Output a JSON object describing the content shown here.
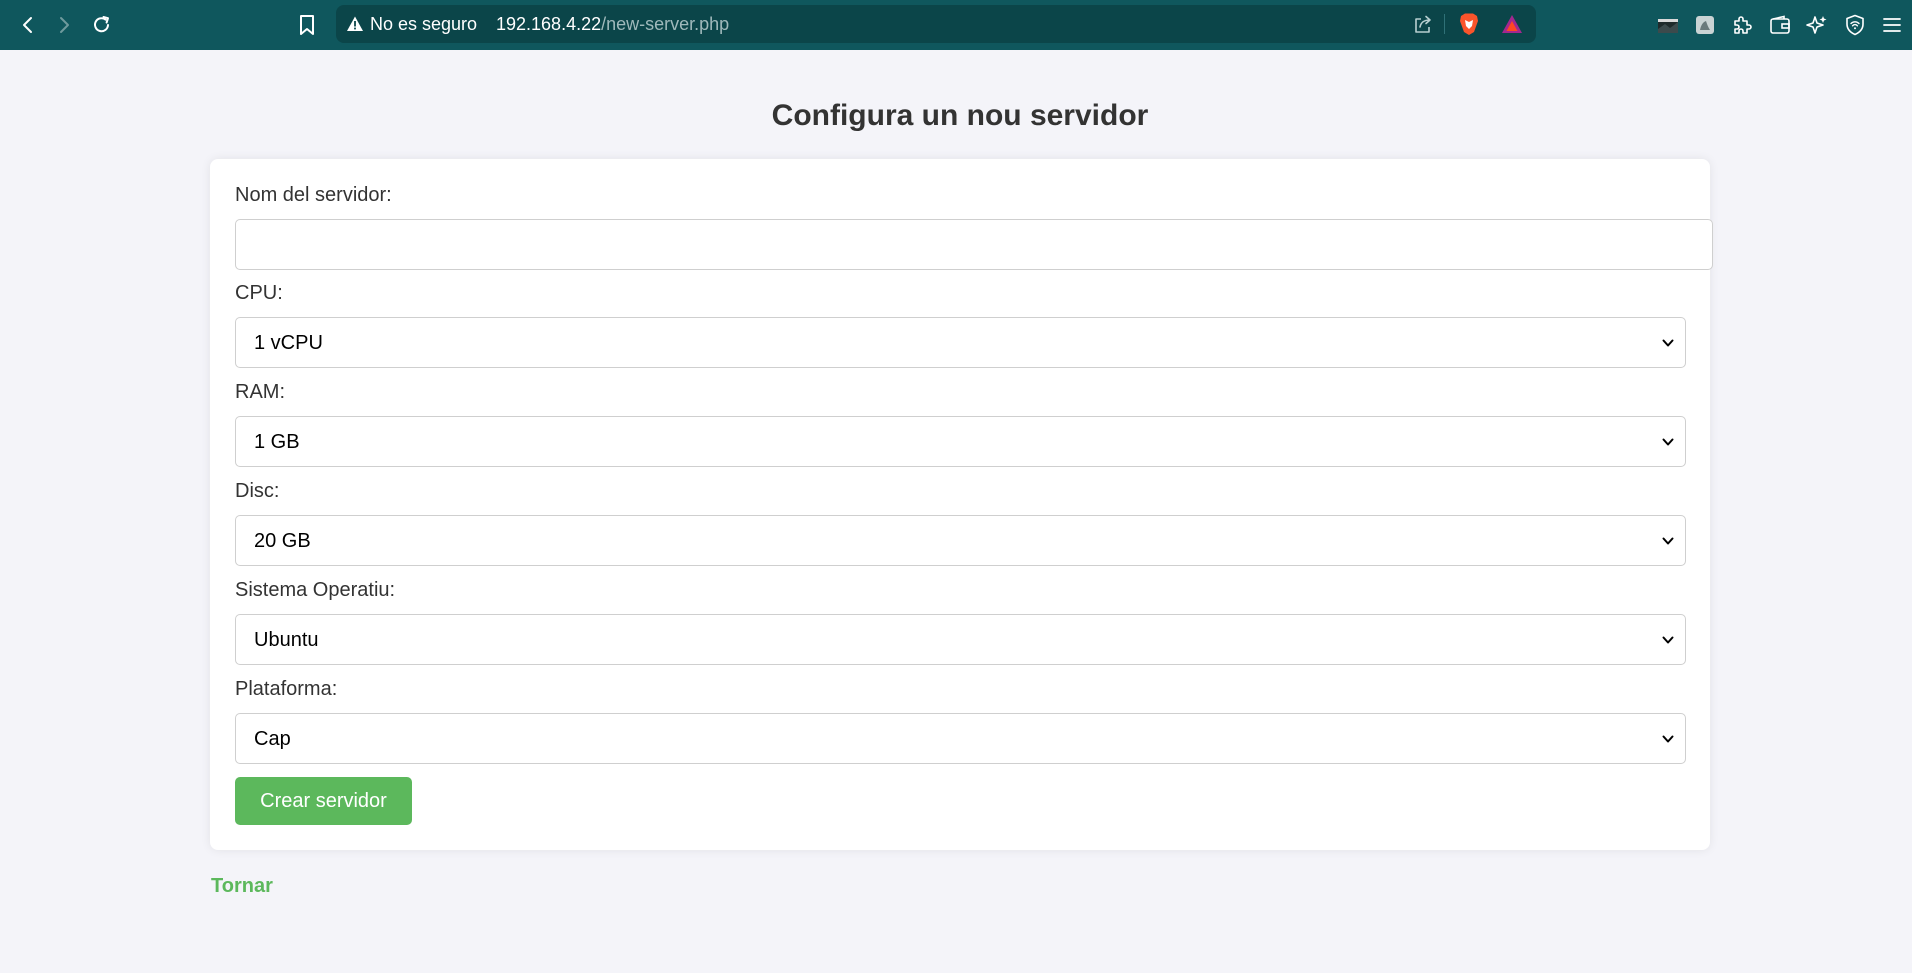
{
  "browser": {
    "security_label": "No es seguro",
    "url_host": "192.168.4.22",
    "url_path": "/new-server.php",
    "toolbar_color": "#0f575d",
    "icons": [
      "back-icon",
      "forward-icon",
      "reload-icon",
      "bookmark-icon",
      "warning-icon",
      "share-icon",
      "brave-shield-icon",
      "brave-rewards-icon",
      "wallpaper-extension-icon",
      "image-extension-icon",
      "extensions-icon",
      "wallet-icon",
      "leo-ai-icon",
      "vpn-icon",
      "menu-icon"
    ]
  },
  "page": {
    "title": "Configura un nou servidor",
    "form": {
      "name_label": "Nom del servidor:",
      "name_value": "",
      "cpu_label": "CPU:",
      "cpu_value": "1 vCPU",
      "ram_label": "RAM:",
      "ram_value": "1 GB",
      "disk_label": "Disc:",
      "disk_value": "20 GB",
      "os_label": "Sistema Operatiu:",
      "os_value": "Ubuntu",
      "platform_label": "Plataforma:",
      "platform_value": "Cap",
      "submit_label": "Crear servidor"
    },
    "back_link": "Tornar",
    "accent_color": "#5cb85c"
  }
}
